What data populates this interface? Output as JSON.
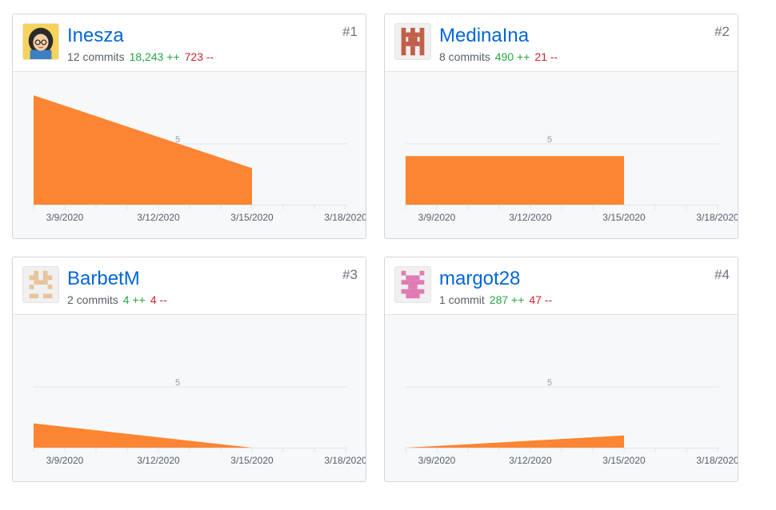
{
  "chart_data": [
    {
      "type": "area",
      "rank": "#1",
      "user": "Inesza",
      "commits": "12 commits",
      "additions": "18,243 ++",
      "deletions": "723 --",
      "avatar_icon": "cartoon-girl-avatar-icon",
      "avatar_color": "#2b2b2b",
      "x_ticks": [
        "3/9/2020",
        "3/12/2020",
        "3/15/2020",
        "3/18/2020"
      ],
      "y_ticks": [
        5
      ],
      "x": [
        "3/8/2020",
        "3/15/2020"
      ],
      "values": [
        9,
        3
      ],
      "ylim": [
        0,
        10
      ]
    },
    {
      "type": "area",
      "rank": "#2",
      "user": "MedinaIna",
      "commits": "8 commits",
      "additions": "490 ++",
      "deletions": "21 --",
      "avatar_icon": "identicon-avatar-icon",
      "avatar_color": "#c0604a",
      "x_ticks": [
        "3/9/2020",
        "3/12/2020",
        "3/15/2020",
        "3/18/2020"
      ],
      "y_ticks": [
        5
      ],
      "x": [
        "3/8/2020",
        "3/15/2020"
      ],
      "values": [
        4,
        4
      ],
      "ylim": [
        0,
        10
      ]
    },
    {
      "type": "area",
      "rank": "#3",
      "user": "BarbetM",
      "commits": "2 commits",
      "additions": "4 ++",
      "deletions": "4 --",
      "avatar_icon": "identicon-avatar-icon",
      "avatar_color": "#e8c49c",
      "x_ticks": [
        "3/9/2020",
        "3/12/2020",
        "3/15/2020",
        "3/18/2020"
      ],
      "y_ticks": [
        5
      ],
      "x": [
        "3/8/2020",
        "3/15/2020"
      ],
      "values": [
        2,
        0
      ],
      "ylim": [
        0,
        10
      ]
    },
    {
      "type": "area",
      "rank": "#4",
      "user": "margot28",
      "commits": "1 commit",
      "additions": "287 ++",
      "deletions": "47 --",
      "avatar_icon": "identicon-avatar-icon",
      "avatar_color": "#e07bb3",
      "x_ticks": [
        "3/9/2020",
        "3/12/2020",
        "3/15/2020",
        "3/18/2020"
      ],
      "y_ticks": [
        5
      ],
      "x": [
        "3/8/2020",
        "3/15/2020"
      ],
      "values": [
        0,
        1
      ],
      "ylim": [
        0,
        10
      ]
    }
  ],
  "colors": {
    "area_fill": "#fb8532",
    "gridline": "#e1e4e8",
    "tick_label": "#586069",
    "additions": "#28a745",
    "deletions": "#cb2431",
    "username": "#0366d6"
  }
}
